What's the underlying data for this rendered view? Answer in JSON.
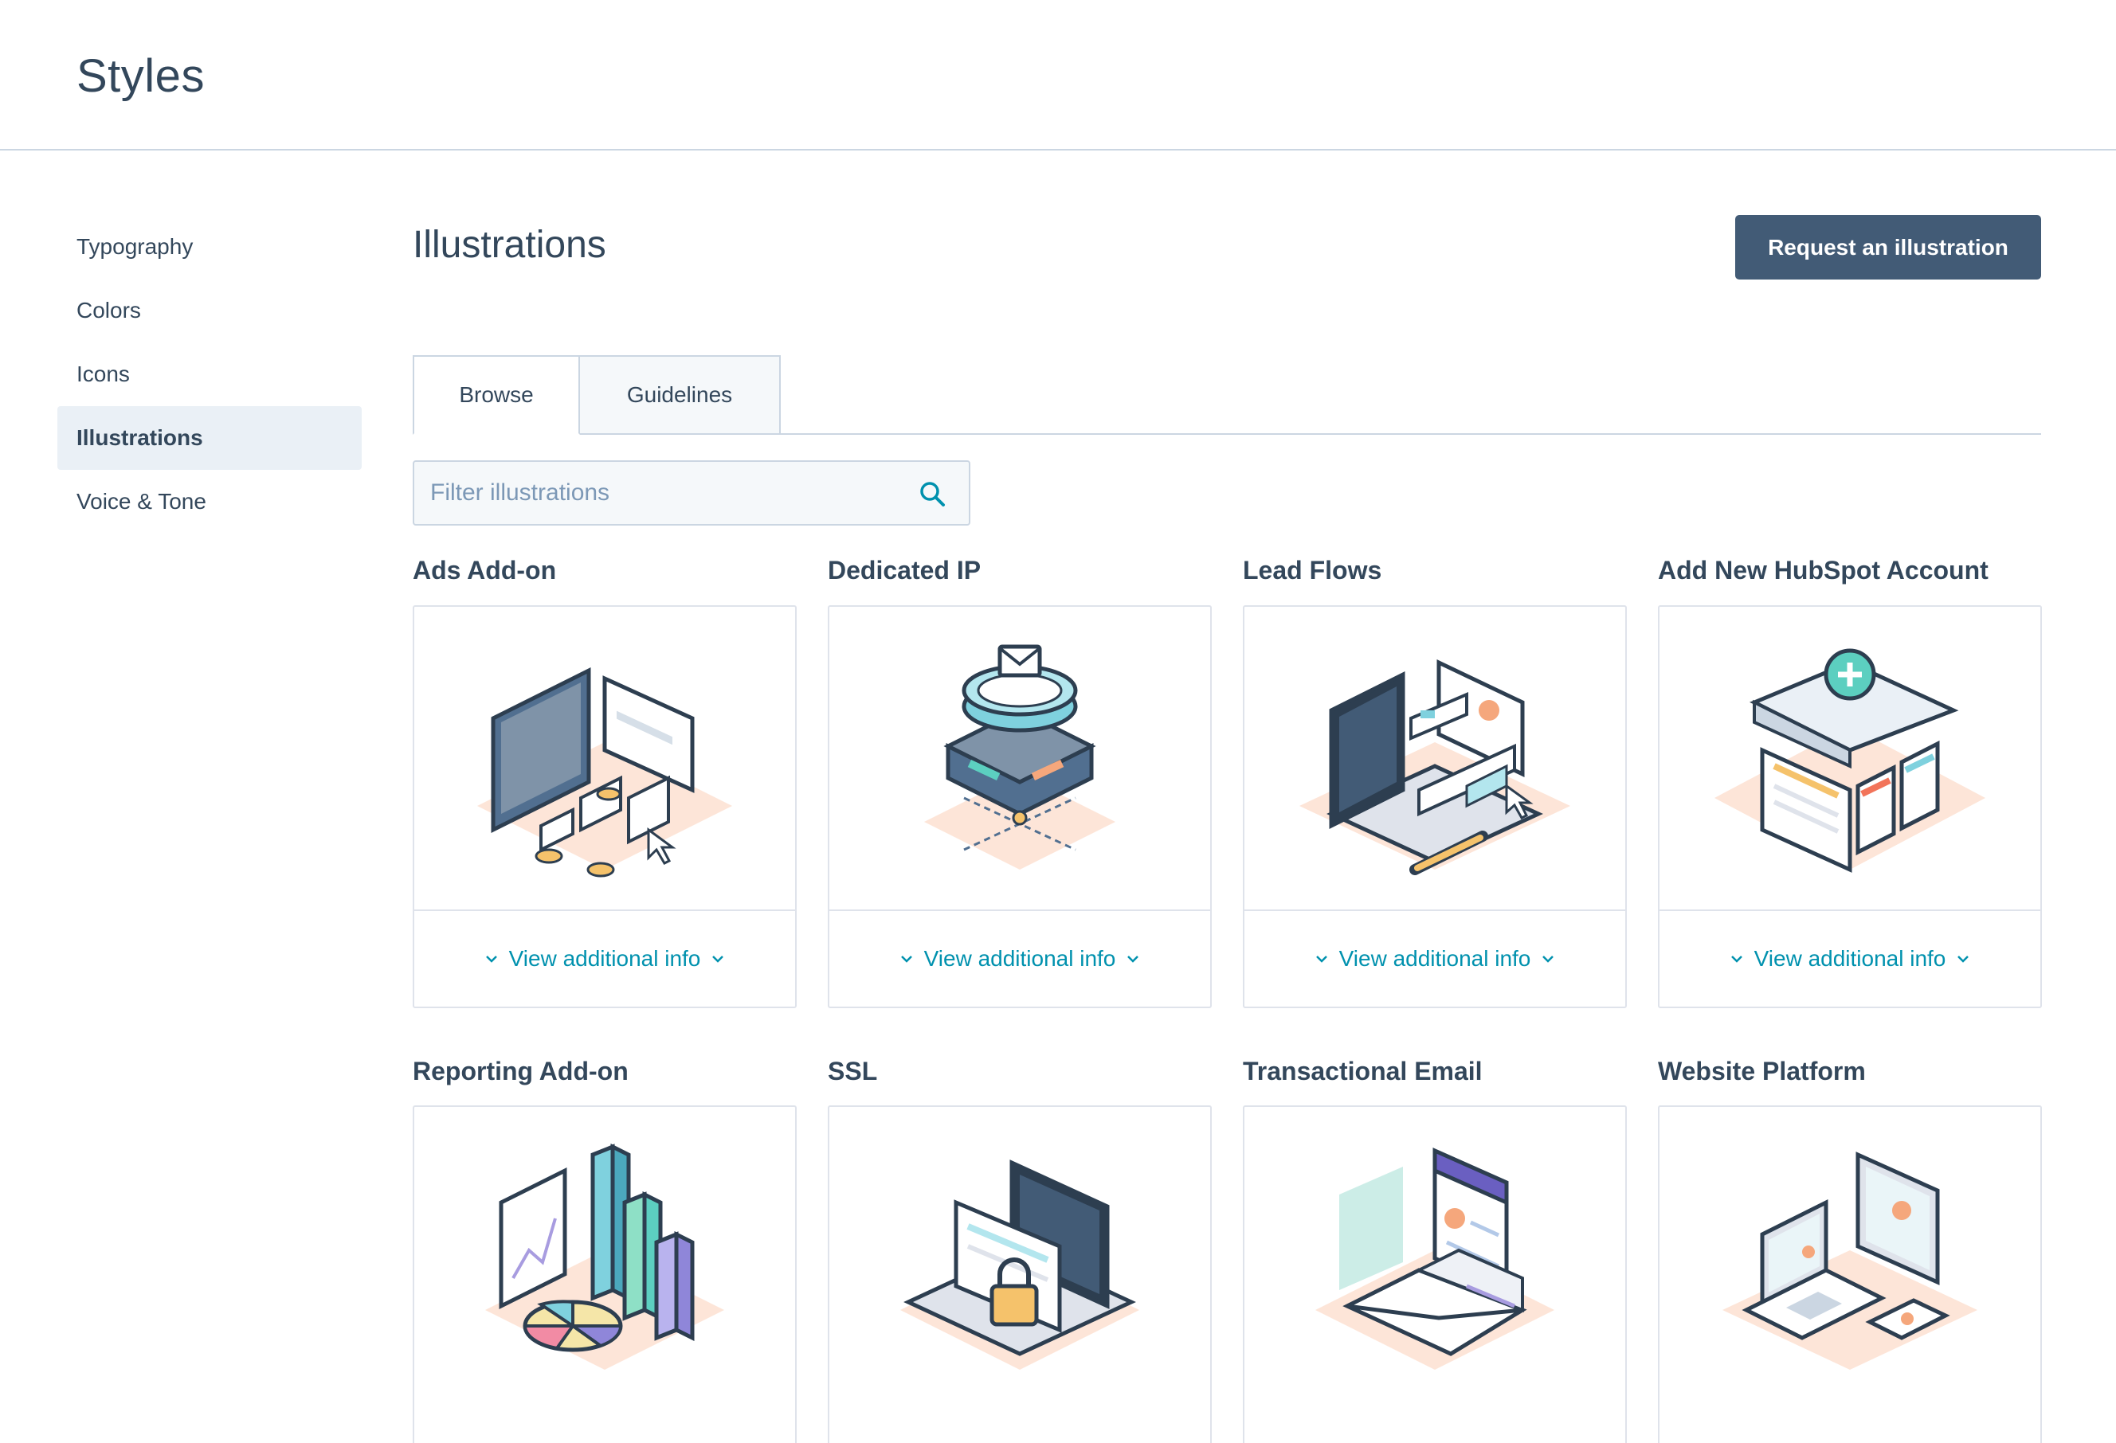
{
  "header": {
    "title": "Styles"
  },
  "sidebar": {
    "items": [
      {
        "label": "Typography",
        "active": false
      },
      {
        "label": "Colors",
        "active": false
      },
      {
        "label": "Icons",
        "active": false
      },
      {
        "label": "Illustrations",
        "active": true
      },
      {
        "label": "Voice & Tone",
        "active": false
      }
    ]
  },
  "main": {
    "title": "Illustrations",
    "request_button": "Request an illustration",
    "tabs": [
      {
        "label": "Browse",
        "selected": true
      },
      {
        "label": "Guidelines",
        "selected": false
      }
    ],
    "filter": {
      "placeholder": "Filter illustrations",
      "value": ""
    },
    "more_info_label": "View additional info",
    "cards": [
      {
        "title": "Ads Add-on",
        "icon": "ads-addon-illustration"
      },
      {
        "title": "Dedicated IP",
        "icon": "dedicated-ip-illustration"
      },
      {
        "title": "Lead Flows",
        "icon": "lead-flows-illustration"
      },
      {
        "title": "Add New HubSpot Account",
        "icon": "add-account-illustration"
      },
      {
        "title": "Reporting Add-on",
        "icon": "reporting-addon-illustration"
      },
      {
        "title": "SSL",
        "icon": "ssl-illustration"
      },
      {
        "title": "Transactional Email",
        "icon": "transactional-email-illustration"
      },
      {
        "title": "Website Platform",
        "icon": "website-platform-illustration"
      }
    ]
  },
  "colors": {
    "primary_text": "#33475b",
    "button_bg": "#425b76",
    "link": "#0091ae",
    "border": "#cbd6e2",
    "active_bg": "#eaf0f6",
    "shadow_tint": "#fde5d8"
  }
}
